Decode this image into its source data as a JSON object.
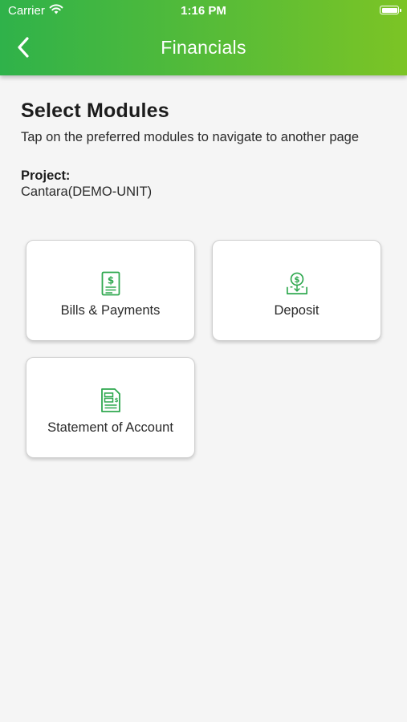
{
  "status_bar": {
    "carrier": "Carrier",
    "time": "1:16 PM"
  },
  "nav": {
    "title": "Financials",
    "back_icon": "chevron-left-icon"
  },
  "page": {
    "title": "Select Modules",
    "subtitle": "Tap on the preferred modules to navigate to another page",
    "project_label": "Project:",
    "project_value": "Cantara(DEMO-UNIT)"
  },
  "modules": [
    {
      "label": "Bills & Payments",
      "icon": "bill-dollar-icon"
    },
    {
      "label": "Deposit",
      "icon": "deposit-icon"
    },
    {
      "label": "Statement of Account",
      "icon": "statement-document-icon"
    }
  ],
  "colors": {
    "header_start": "#2fb24a",
    "header_end": "#7cc425",
    "icon_green": "#2fa84f",
    "background": "#f5f5f5"
  }
}
